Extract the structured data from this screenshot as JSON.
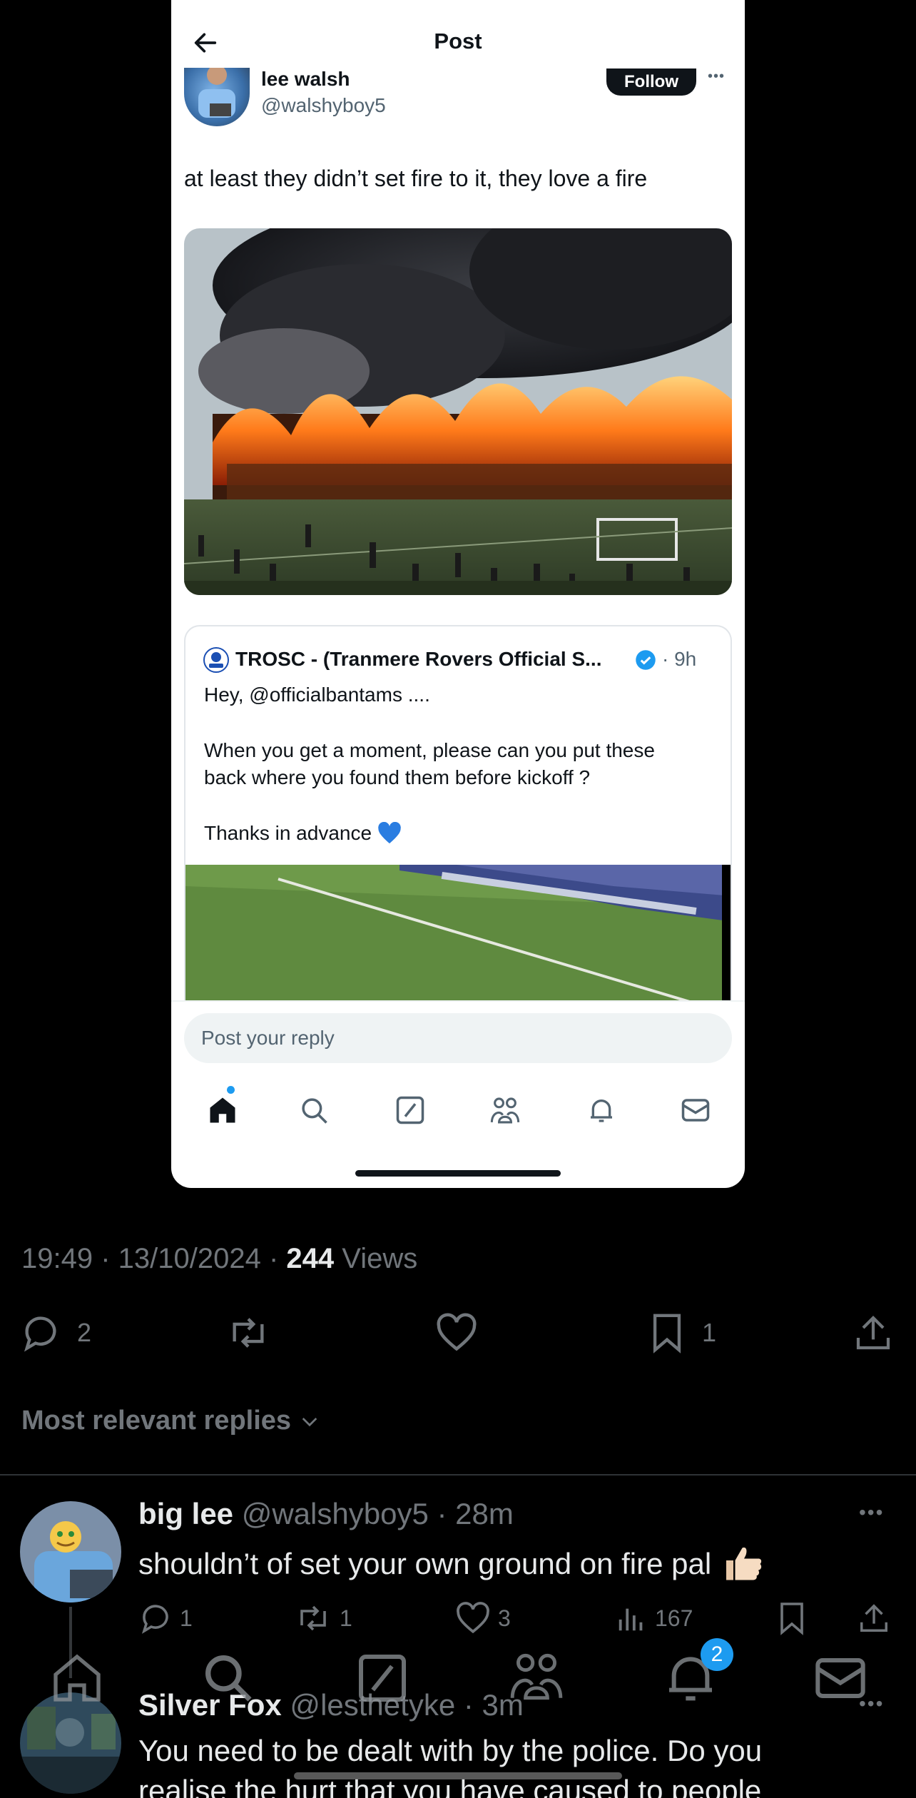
{
  "screenshot": {
    "header_title": "Post",
    "author": {
      "name": "lee walsh",
      "handle": "@walshyboy5"
    },
    "follow_label": "Follow",
    "post_text": "at least they didn’t set fire to it, they love a fire",
    "quote": {
      "name": "TROSC - (Tranmere Rovers Official S...",
      "time": "· 9h",
      "lines": [
        "Hey, @officialbantams ....",
        "When you get a moment, please can you put these",
        "back where you found them before kickoff ?",
        "Thanks in advance"
      ]
    },
    "reply_placeholder": "Post your reply"
  },
  "post_meta": {
    "time": "19:49 · 13/10/2024 · ",
    "views_count": "244",
    "views_label": " Views"
  },
  "actions": {
    "replies": "2",
    "bookmarks": "1"
  },
  "replies_sort": "Most relevant replies",
  "replies": [
    {
      "name": "big lee",
      "handle_time": " @walshyboy5 · 28m",
      "text": "shouldn’t of set your own ground on fire pal",
      "replies": "1",
      "reposts": "1",
      "likes": "3",
      "views": "167"
    },
    {
      "name": "Silver Fox",
      "handle_time": " @lesthetyke · 3m",
      "text": "You need to be dealt with by the police. Do you",
      "text2": "realise the hurt that you have caused to people"
    }
  ],
  "notification_badge": "2",
  "colors": {
    "accent": "#1d9bf0",
    "background": "#000000",
    "muted": "#71767b"
  }
}
